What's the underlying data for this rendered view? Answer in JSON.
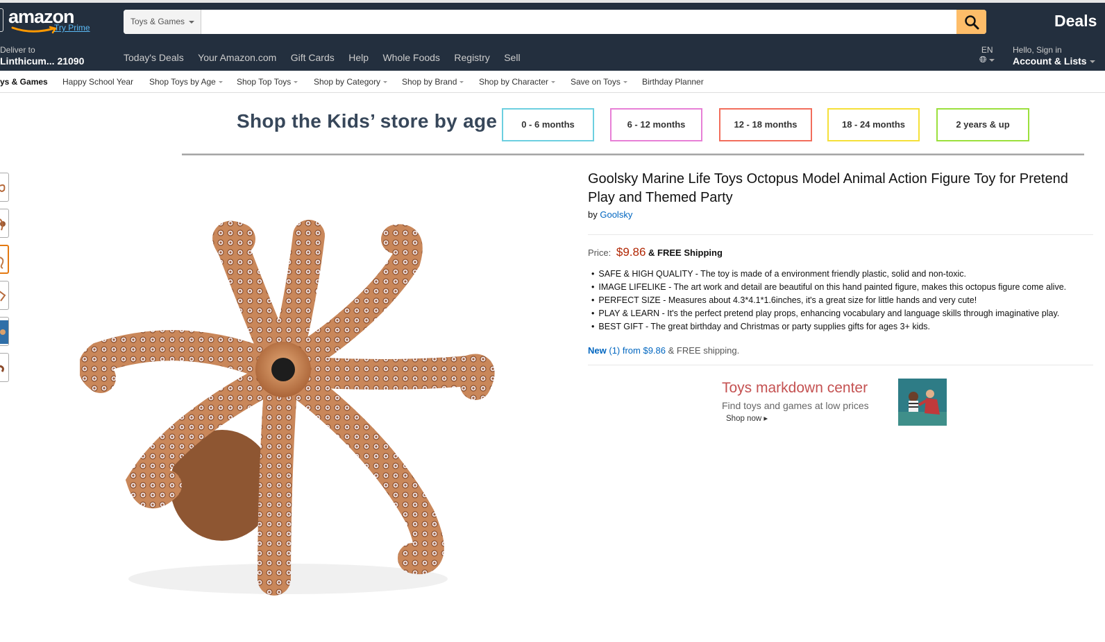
{
  "header": {
    "logo_text": "amazon",
    "try_prime": "Try Prime",
    "search_department": "Toys & Games",
    "search_placeholder": "",
    "deals": "Deals"
  },
  "nav": {
    "deliver_label": "Deliver to",
    "deliver_location": "Linthicum... 21090",
    "links": [
      "Today's Deals",
      "Your Amazon.com",
      "Gift Cards",
      "Help",
      "Whole Foods",
      "Registry",
      "Sell"
    ],
    "language": "EN",
    "account_greeting": "Hello, Sign in",
    "account_lists": "Account & Lists"
  },
  "subnav": {
    "items": [
      "ys & Games",
      "Happy School Year",
      "Shop Toys by Age",
      "Shop Top Toys",
      "Shop by Category",
      "Shop by Brand",
      "Shop by Character",
      "Save on Toys",
      "Birthday Planner"
    ]
  },
  "age_banner": {
    "title": "Shop the Kids’ store by age",
    "buttons": [
      {
        "label": "0 - 6 months",
        "color": "#6ccfe0"
      },
      {
        "label": "6 - 12 months",
        "color": "#e77fd6"
      },
      {
        "label": "12 - 18 months",
        "color": "#f26d5b"
      },
      {
        "label": "18 - 24 months",
        "color": "#f5e038"
      },
      {
        "label": "2 years & up",
        "color": "#9be03c"
      }
    ]
  },
  "product": {
    "title": "Goolsky Marine Life Toys Octopus Model Animal Action Figure Toy for Pretend Play and Themed Party",
    "by_label": "by",
    "brand": "Goolsky",
    "price_label": "Price:",
    "price": "$9.86",
    "shipping": "& FREE Shipping",
    "bullets": [
      "SAFE & HIGH QUALITY - The toy is made of a environment friendly plastic, solid and non-toxic.",
      "IMAGE LIFELIKE - The art work and detail are beautiful on this hand painted figure, makes this octopus figure come alive.",
      "PERFECT SIZE - Measures about 4.3*4.1*1.6inches, it's a great size for little hands and very cute!",
      "PLAY & LEARN - It's the perfect pretend play props, enhancing vocabulary and language skills through imaginative play.",
      "BEST GIFT - The great birthday and Christmas or party supplies gifts for ages 3+ kids."
    ],
    "offers_new": "New",
    "offers_count_link": "(1) from $9.86",
    "offers_shipping": "& FREE shipping."
  },
  "markdown": {
    "title": "Toys markdown center",
    "subtitle": "Find toys and games at low prices",
    "cta": "Shop now"
  },
  "colors": {
    "nav_bg": "#232f3e",
    "search_button": "#febd69",
    "price": "#b12704",
    "link": "#0066c0",
    "age_title": "#37475a"
  }
}
